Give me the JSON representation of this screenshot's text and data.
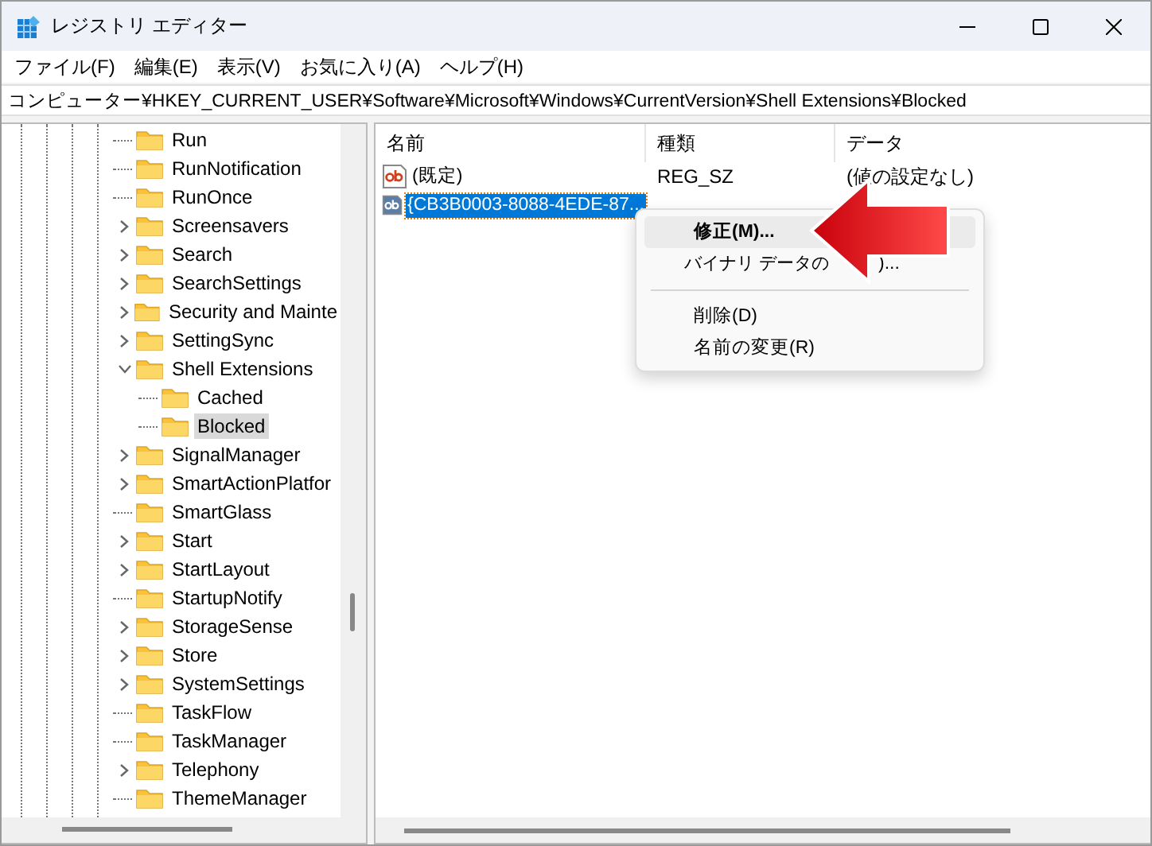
{
  "window": {
    "title": "レジストリ エディター"
  },
  "menu": [
    "ファイル(F)",
    "編集(E)",
    "表示(V)",
    "お気に入り(A)",
    "ヘルプ(H)"
  ],
  "address": "コンピューター¥HKEY_CURRENT_USER¥Software¥Microsoft¥Windows¥CurrentVersion¥Shell Extensions¥Blocked",
  "tree": [
    {
      "label": "Run",
      "kind": "leaf",
      "selected": false
    },
    {
      "label": "RunNotification",
      "kind": "leaf",
      "selected": false
    },
    {
      "label": "RunOnce",
      "kind": "leaf",
      "selected": false
    },
    {
      "label": "Screensavers",
      "kind": "collapsed",
      "selected": false
    },
    {
      "label": "Search",
      "kind": "collapsed",
      "selected": false
    },
    {
      "label": "SearchSettings",
      "kind": "collapsed",
      "selected": false
    },
    {
      "label": "Security and Mainte",
      "kind": "collapsed",
      "selected": false
    },
    {
      "label": "SettingSync",
      "kind": "collapsed",
      "selected": false
    },
    {
      "label": "Shell Extensions",
      "kind": "expanded",
      "selected": false,
      "children": [
        {
          "label": "Cached",
          "kind": "leaf",
          "selected": false
        },
        {
          "label": "Blocked",
          "kind": "leaf",
          "selected": true
        }
      ]
    },
    {
      "label": "SignalManager",
      "kind": "collapsed",
      "selected": false
    },
    {
      "label": "SmartActionPlatfor",
      "kind": "collapsed",
      "selected": false
    },
    {
      "label": "SmartGlass",
      "kind": "leaf",
      "selected": false
    },
    {
      "label": "Start",
      "kind": "collapsed",
      "selected": false
    },
    {
      "label": "StartLayout",
      "kind": "collapsed",
      "selected": false
    },
    {
      "label": "StartupNotify",
      "kind": "leaf",
      "selected": false
    },
    {
      "label": "StorageSense",
      "kind": "collapsed",
      "selected": false
    },
    {
      "label": "Store",
      "kind": "collapsed",
      "selected": false
    },
    {
      "label": "SystemSettings",
      "kind": "collapsed",
      "selected": false
    },
    {
      "label": "TaskFlow",
      "kind": "leaf",
      "selected": false
    },
    {
      "label": "TaskManager",
      "kind": "leaf",
      "selected": false
    },
    {
      "label": "Telephony",
      "kind": "collapsed",
      "selected": false
    },
    {
      "label": "ThemeManager",
      "kind": "leaf",
      "selected": false
    }
  ],
  "table": {
    "columns": [
      "名前",
      "種類",
      "データ"
    ],
    "rows": [
      {
        "name": "(既定)",
        "type": "REG_SZ",
        "data": "(値の設定なし)",
        "selected": false
      },
      {
        "name": "{CB3B0003-8088-4EDE-87...",
        "selected": true
      }
    ]
  },
  "context_menu": [
    {
      "label": "修正(M)...",
      "kind": "item",
      "default": true,
      "selected": true
    },
    {
      "label": "バイナリ データの",
      "tail": ")...",
      "kind": "item",
      "default": false,
      "selected": false
    },
    {
      "kind": "separator"
    },
    {
      "label": "削除(D)",
      "kind": "item",
      "default": false,
      "selected": false
    },
    {
      "label": "名前の変更(R)",
      "kind": "item",
      "default": false,
      "selected": false
    }
  ]
}
